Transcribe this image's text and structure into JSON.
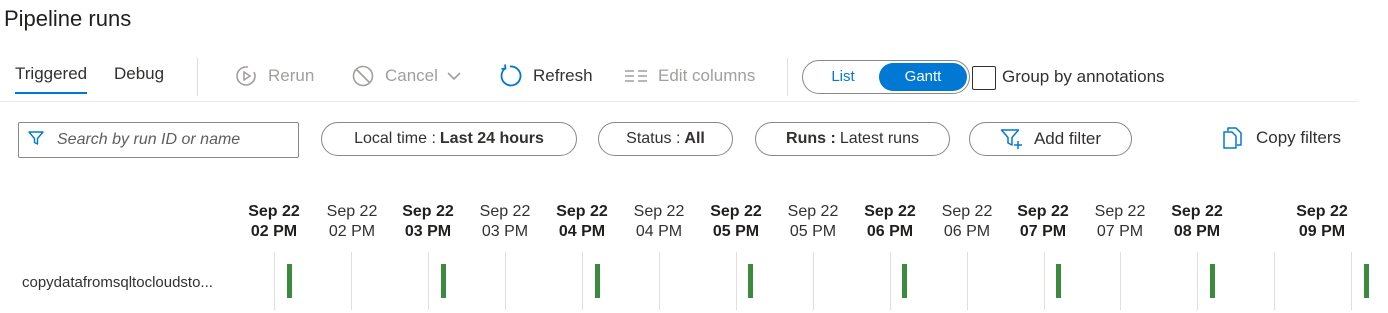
{
  "page": {
    "title": "Pipeline runs"
  },
  "tabs": [
    {
      "label": "Triggered",
      "active": true
    },
    {
      "label": "Debug",
      "active": false
    }
  ],
  "toolbar": {
    "rerun_label": "Rerun",
    "cancel_label": "Cancel",
    "refresh_label": "Refresh",
    "edit_columns_label": "Edit columns",
    "view_toggle": {
      "options": [
        "List",
        "Gantt"
      ],
      "selected": "Gantt"
    },
    "group_by_label": "Group by annotations",
    "group_by_checked": false
  },
  "filters": {
    "search_placeholder": "Search by run ID or name",
    "local_time_key": "Local time :",
    "local_time_value": "Last 24 hours",
    "status_key": "Status :",
    "status_value": "All",
    "runs_key": "Runs :",
    "runs_value": "Latest runs",
    "add_filter_label": "Add filter",
    "copy_filters_label": "Copy filters"
  },
  "gantt": {
    "ticks": [
      {
        "date": "Sep 22",
        "time": "02 PM",
        "bold": true
      },
      {
        "date": "Sep 22",
        "time": "02 PM",
        "bold": false
      },
      {
        "date": "Sep 22",
        "time": "03 PM",
        "bold": true
      },
      {
        "date": "Sep 22",
        "time": "03 PM",
        "bold": false
      },
      {
        "date": "Sep 22",
        "time": "04 PM",
        "bold": true
      },
      {
        "date": "Sep 22",
        "time": "04 PM",
        "bold": false
      },
      {
        "date": "Sep 22",
        "time": "05 PM",
        "bold": true
      },
      {
        "date": "Sep 22",
        "time": "05 PM",
        "bold": false
      },
      {
        "date": "Sep 22",
        "time": "06 PM",
        "bold": true
      },
      {
        "date": "Sep 22",
        "time": "06 PM",
        "bold": false
      },
      {
        "date": "Sep 22",
        "time": "07 PM",
        "bold": true
      },
      {
        "date": "Sep 22",
        "time": "07 PM",
        "bold": false
      },
      {
        "date": "Sep 22",
        "time": "08 PM",
        "bold": true
      },
      {
        "date": "Sep 22",
        "time": "09 PM",
        "bold": true
      }
    ],
    "row_label": "copydatafromsqltocloudsto...",
    "run_status_color": "#3b8a3e"
  },
  "colors": {
    "accent": "#0078d4",
    "success": "#3b8a3e"
  }
}
